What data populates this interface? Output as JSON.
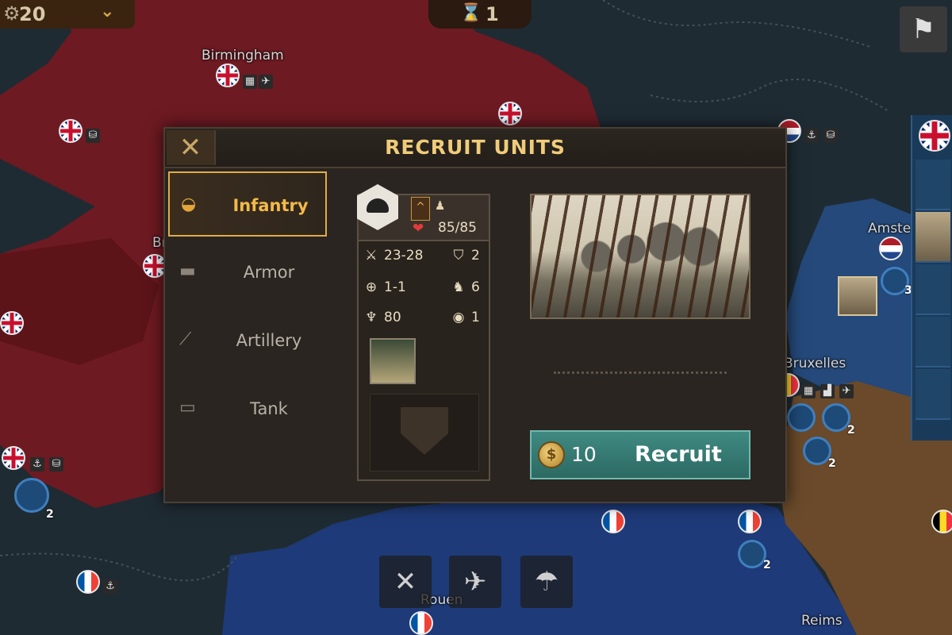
{
  "map": {
    "labels": {
      "birmingham": "Birmingham",
      "bristol": "Bristol",
      "amsterdam": "Amste",
      "bruxelles": "Bruxelles",
      "rouen": "Rouen",
      "reims": "Reims"
    },
    "top_counter_left": "20",
    "top_counter_mid": "1",
    "unit_counts": {
      "a": "2",
      "b": "2",
      "c": "3",
      "d": "2",
      "e": "2"
    }
  },
  "modal": {
    "title": "RECRUIT UNITS",
    "close_glyph": "✕",
    "tabs": [
      {
        "label": "Infantry",
        "active": true,
        "icon": "helmet-icon"
      },
      {
        "label": "Armor",
        "active": false,
        "icon": "armored-car-icon"
      },
      {
        "label": "Artillery",
        "active": false,
        "icon": "artillery-icon"
      },
      {
        "label": "Tank",
        "active": false,
        "icon": "tank-icon"
      }
    ],
    "unit": {
      "hp": "85/85",
      "attack": "23-28",
      "defense": "2",
      "range": "1-1",
      "movement": "6",
      "organization": "80",
      "vision": "1"
    },
    "recruit": {
      "cost": "10",
      "label": "Recruit"
    }
  },
  "colors": {
    "accent": "#f0cc7a",
    "active_tab": "#e1ac48",
    "recruit_bg": "#3f8a82",
    "uk_territory": "#6e1a22",
    "fr_territory": "#1e3a78",
    "de_territory": "#6a4a2a",
    "sea": "#1f2b33"
  }
}
